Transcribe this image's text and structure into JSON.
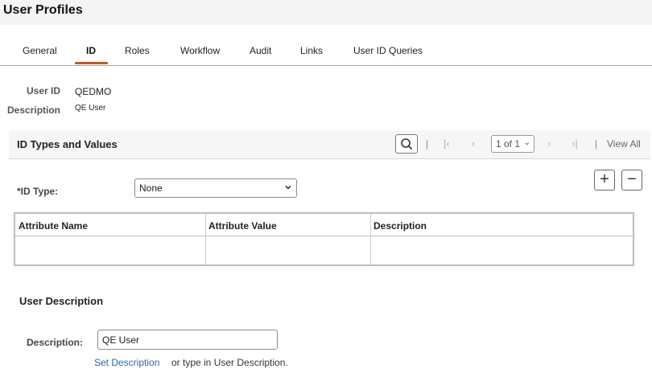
{
  "header": {
    "title": "User Profiles"
  },
  "tabs": [
    {
      "label": "General"
    },
    {
      "label": "ID"
    },
    {
      "label": "Roles"
    },
    {
      "label": "Workflow"
    },
    {
      "label": "Audit"
    },
    {
      "label": "Links"
    },
    {
      "label": "User ID Queries"
    }
  ],
  "active_tab": "ID",
  "info": {
    "user_id_label": "User ID",
    "user_id_value": "QEDMO",
    "description_label": "Description",
    "description_value": "QE User"
  },
  "grid": {
    "title": "ID Types and Values",
    "separator": "|",
    "pager_value": "1 of 1",
    "view_all": "View All",
    "icons": [
      "search-icon",
      "first-page-icon",
      "previous-page-icon",
      "chevron-down-icon",
      "next-page-icon",
      "last-page-icon"
    ]
  },
  "id_type": {
    "label": "*ID Type:",
    "selected": "None"
  },
  "row_buttons": {
    "add": "+",
    "remove": "−"
  },
  "table": {
    "columns": [
      "Attribute Name",
      "Attribute Value",
      "Description"
    ],
    "rows": [
      [
        "",
        "",
        ""
      ]
    ]
  },
  "user_description": {
    "section_title": "User Description",
    "field_label": "Description:",
    "field_value": "QE User",
    "link_label": "Set Description",
    "hint": "or type in User Description."
  },
  "colors": {
    "accent_underline": "#c0582b",
    "link": "#2e66b3",
    "header_bg": "#f4f4f4"
  }
}
